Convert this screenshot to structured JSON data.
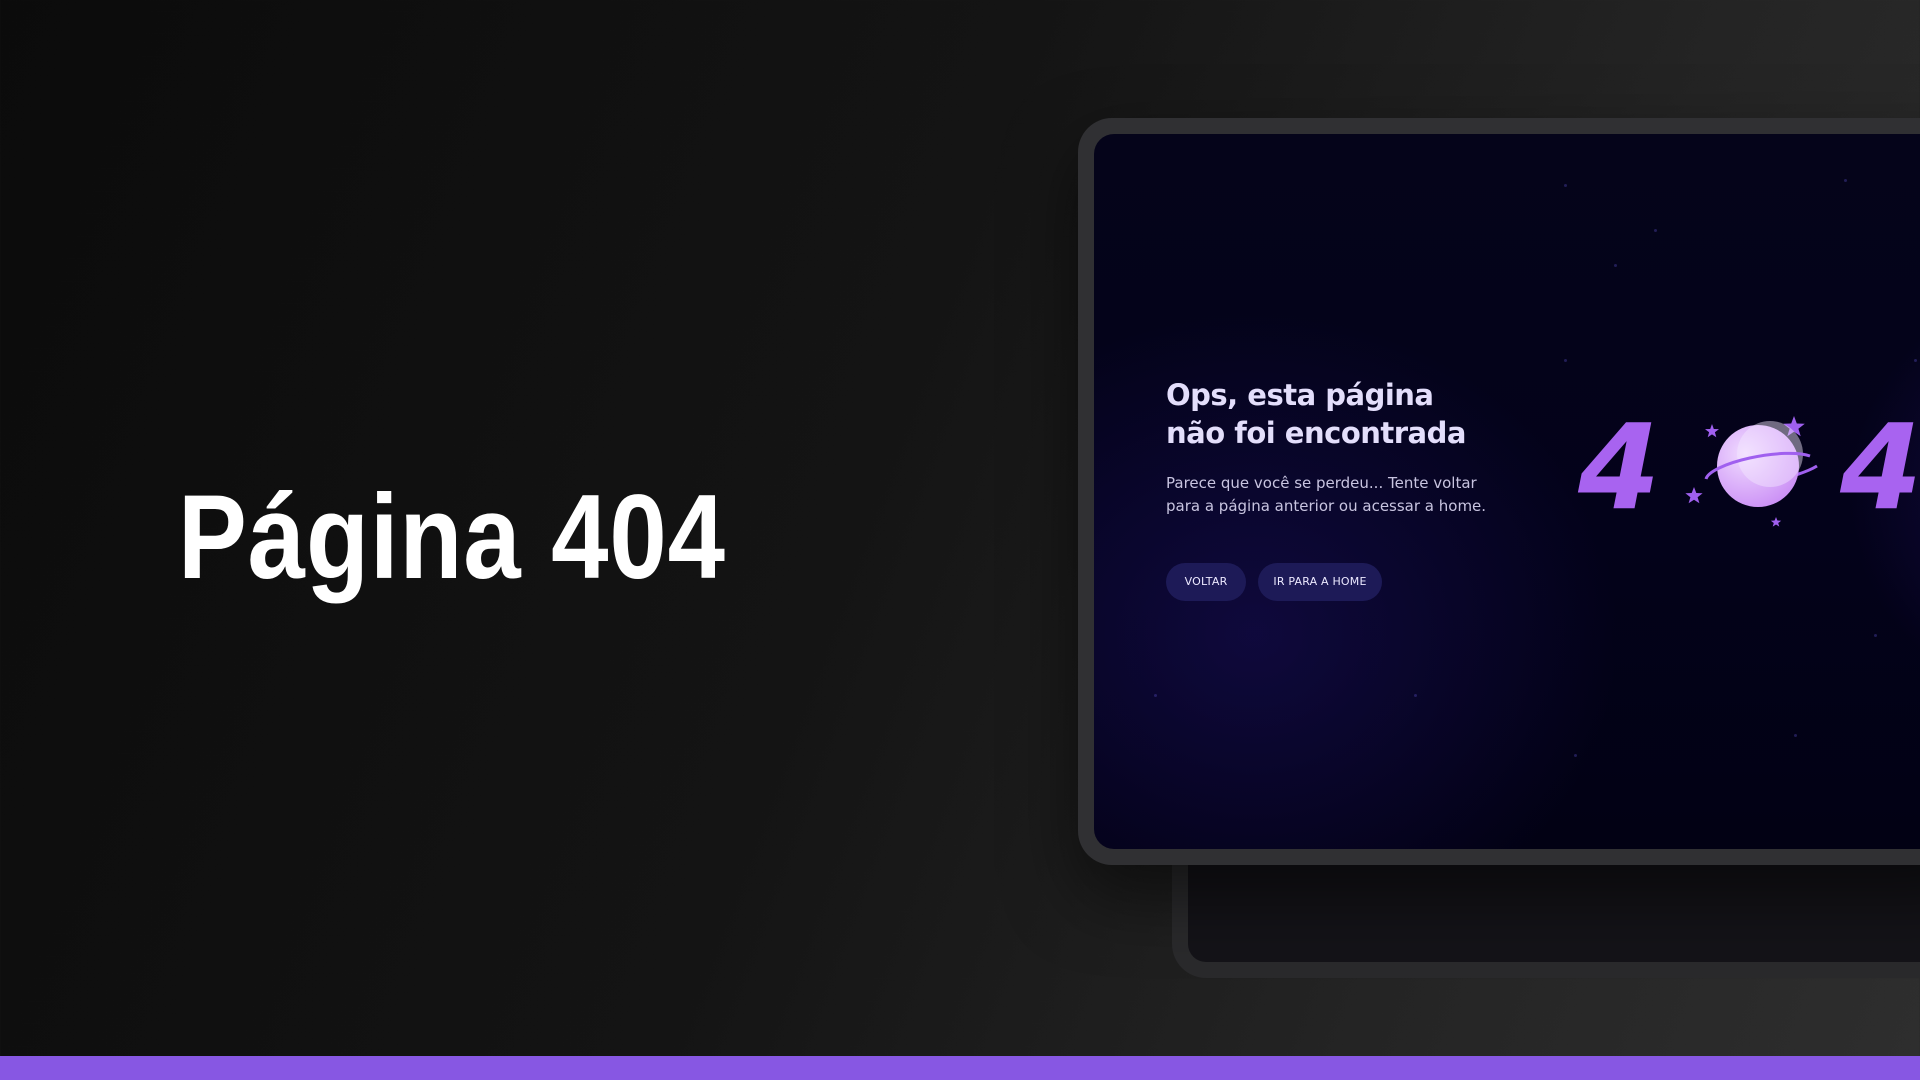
{
  "headline": "Página 404",
  "screen": {
    "title_line1": "Ops, esta página",
    "title_line2": "não foi encontrada",
    "description_line1": "Parece que você se perdeu... Tente voltar",
    "description_line2": "para a página anterior ou acessar a home.",
    "back_button": "VOLTAR",
    "home_button": "IR PARA A HOME",
    "digit_left": "4",
    "digit_right": "4",
    "illustration_icon": "planet-with-stars-icon"
  },
  "colors": {
    "accent_bar": "#8757e3",
    "digits": "#a863f0",
    "planet": "#e0c0ff",
    "button_bg": "#1d1a57",
    "screen_bg": "#05041a"
  }
}
